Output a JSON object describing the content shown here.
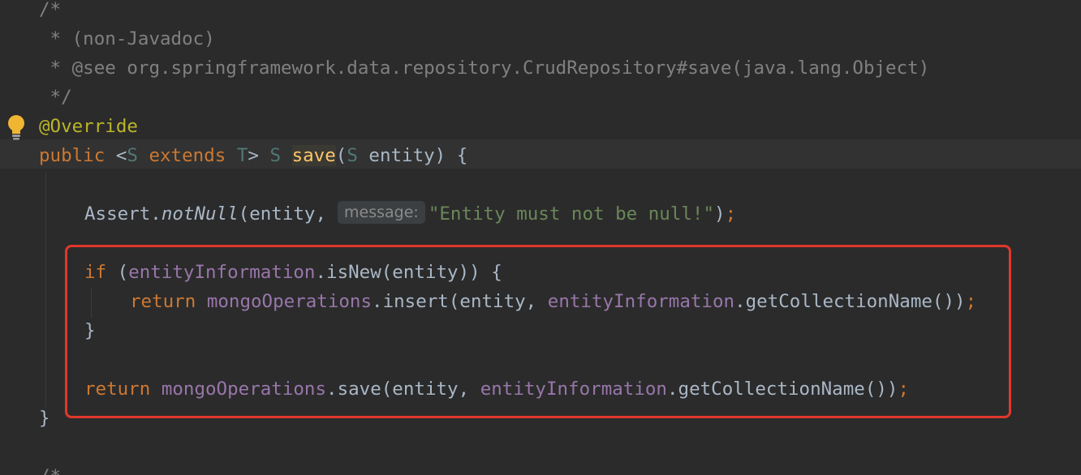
{
  "editor": {
    "lines": {
      "comment_open": "/*",
      "comment_nonjavadoc": " * (non-Javadoc)",
      "comment_see": " * @see org.springframework.data.repository.CrudRepository#save(java.lang.Object)",
      "comment_close": " */",
      "annotation": "@Override",
      "sig_public": "public",
      "sig_lt": " <",
      "sig_S1": "S",
      "sig_extends": " extends ",
      "sig_T": "T",
      "sig_gt": "> ",
      "sig_S2": "S",
      "sig_space": " ",
      "sig_method": "save",
      "sig_paren_open": "(",
      "sig_S3": "S",
      "sig_params_rest": " entity) {",
      "assert_class": "Assert.",
      "assert_method": "notNull",
      "assert_args": "(entity,",
      "assert_hint": "message:",
      "assert_string": "\"Entity must not be null!\"",
      "assert_end": ")",
      "assert_semi": ";",
      "if_kw": "if",
      "if_paren": " (",
      "if_field": "entityInformation",
      "if_rest": ".isNew(entity)) {",
      "ret1_kw": "return",
      "ret1_space": " ",
      "ret1_field": "mongoOperations",
      "ret1_mid": ".insert(entity, ",
      "ret1_field2": "entityInformation",
      "ret1_rest": ".getCollectionName())",
      "ret1_semi": ";",
      "if_close": "}",
      "ret2_kw": "return",
      "ret2_space": " ",
      "ret2_field": "mongoOperations",
      "ret2_mid": ".save(entity, ",
      "ret2_field2": "entityInformation",
      "ret2_rest": ".getCollectionName())",
      "ret2_semi": ";",
      "method_close": "}",
      "next_comment": "/*"
    },
    "gutter": {
      "intention_icon": "lightbulb-icon"
    },
    "colors": {
      "background": "#2b2b2b",
      "keyword": "#cc7832",
      "comment": "#808080",
      "annotation": "#bbb529",
      "method": "#ffc66d",
      "field": "#9876aa",
      "string": "#6a8759",
      "highlight_box": "#e0382b"
    }
  }
}
